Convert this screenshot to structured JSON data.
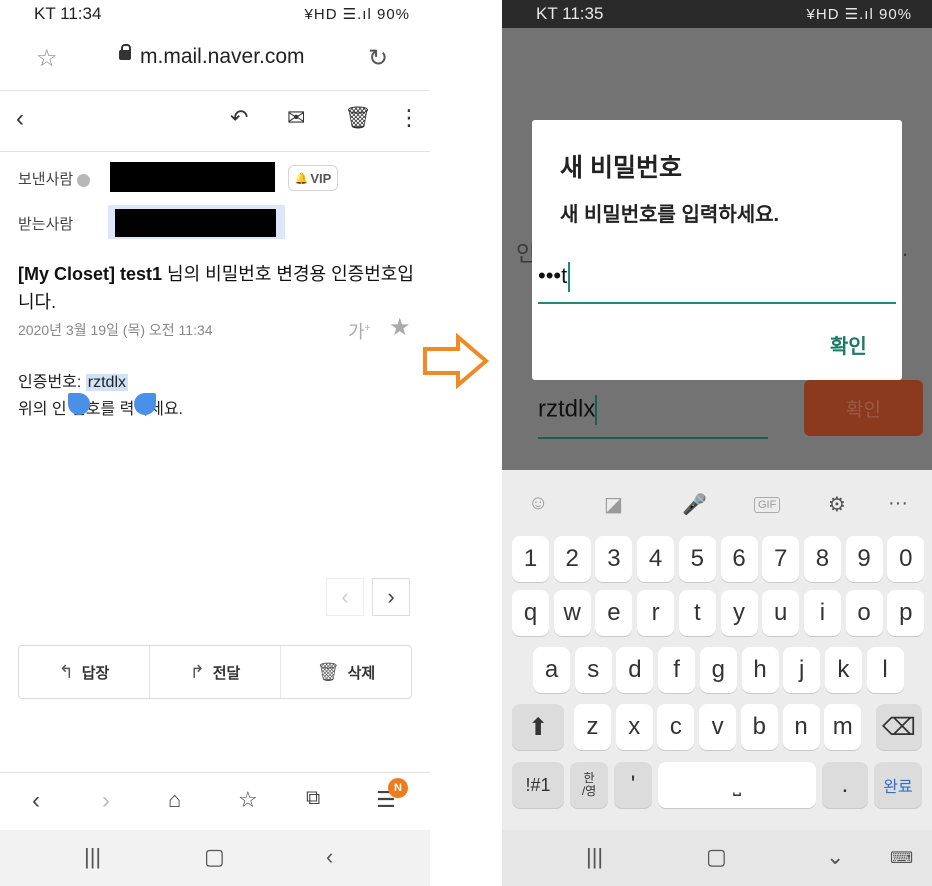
{
  "left_phone": {
    "status": {
      "carrier_time": "KT 11:34",
      "icons": "¥HD ☰.ıl 90%"
    },
    "url_bar": {
      "url": "m.mail.naver.com"
    },
    "mail": {
      "sender_label": "보낸사람",
      "recipient_label": "받는사람",
      "vip_label": "VIP",
      "subject_bold": "[My Closet] test1",
      "subject_rest": " 님의 비밀번호 변경용 인증번호입니다.",
      "date": "2020년 3월 19일 (목) 오전 11:34",
      "font_size_icon_text": "가",
      "code_prefix": "인증번호: ",
      "code_value": "rztdlx",
      "instruction": "위의 인 번호를 력하세요."
    },
    "actions": [
      {
        "icon": "↰",
        "label": "답장"
      },
      {
        "icon": "↱",
        "label": "전달"
      },
      {
        "icon": "🗑",
        "label": "삭제"
      }
    ],
    "badge": "N"
  },
  "right_phone": {
    "status": {
      "carrier_time": "KT 11:35",
      "icons": "¥HD ☰.ıl 90%"
    },
    "background": {
      "input_value": "rztdlx",
      "button_label": "확인",
      "text_left": "인",
      "text_right": "."
    },
    "dialog": {
      "title": "새 비밀번호",
      "message": "새 비밀번호를 입력하세요.",
      "input_value": "•••t",
      "ok_label": "확인"
    },
    "keyboard": {
      "number_row": [
        "1",
        "2",
        "3",
        "4",
        "5",
        "6",
        "7",
        "8",
        "9",
        "0"
      ],
      "row1": [
        "q",
        "w",
        "e",
        "r",
        "t",
        "y",
        "u",
        "i",
        "o",
        "p"
      ],
      "row2": [
        "a",
        "s",
        "d",
        "f",
        "g",
        "h",
        "j",
        "k",
        "l"
      ],
      "row3": [
        "z",
        "x",
        "c",
        "v",
        "b",
        "n",
        "m"
      ],
      "symbols_label": "!#1",
      "lang_label_top": "한",
      "lang_label_bottom": "/영",
      "apostrophe": "'",
      "period": ".",
      "done_label": "완료",
      "gif_label": "GIF"
    }
  },
  "colors": {
    "arrow": "#f08a24",
    "accent_green": "#1b8c78",
    "badge_orange": "#f07b1f"
  }
}
